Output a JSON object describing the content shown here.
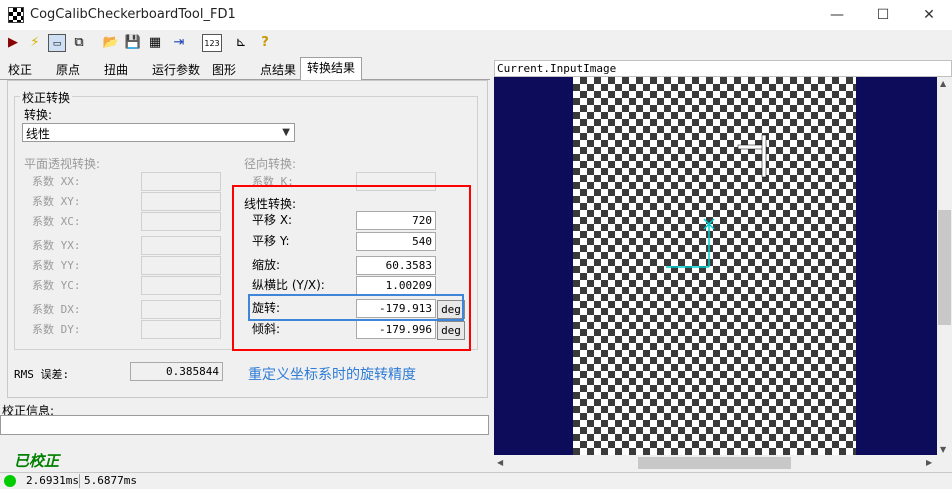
{
  "window": {
    "title": "CogCalibCheckerboardTool_FD1"
  },
  "window_controls": {
    "minimize": "—",
    "maximize": "☐",
    "close": "✕"
  },
  "tabs": [
    {
      "label": "校正"
    },
    {
      "label": "原点"
    },
    {
      "label": "扭曲"
    },
    {
      "label": "运行参数"
    },
    {
      "label": "图形"
    },
    {
      "label": "点结果"
    },
    {
      "label": "转换结果",
      "active": true
    }
  ],
  "calib_transform": {
    "group_title": "校正转换",
    "transform_label": "转换:",
    "transform_value": "线性"
  },
  "perspective": {
    "title": "平面透视转换:",
    "rows": [
      "系数 XX:",
      "系数 XY:",
      "系数 XC:",
      "系数 YX:",
      "系数 YY:",
      "系数 YC:",
      "系数 DX:",
      "系数 DY:"
    ]
  },
  "radial": {
    "title": "径向转换:",
    "k_label": "系数 K:"
  },
  "linear": {
    "title": "线性转换:",
    "translate_x_label": "平移 X:",
    "translate_x": "720",
    "translate_y_label": "平移 Y:",
    "translate_y": "540",
    "scale_label": "缩放:",
    "scale": "60.3583",
    "aspect_label": "纵横比 (Y/X):",
    "aspect": "1.00209",
    "rotation_label": "旋转:",
    "rotation": "-179.913",
    "skew_label": "倾斜:",
    "skew": "-179.996",
    "deg_label": "deg"
  },
  "rms": {
    "label": "RMS 误差:",
    "value": "0.385844"
  },
  "annotation": {
    "text": "重定义坐标系时的旋转精度"
  },
  "calib_info": {
    "label": "校正信息:"
  },
  "status": {
    "calibrated": "已校正",
    "time1": "2.6931ms",
    "time2": "5.6877ms"
  },
  "image_display": {
    "title": "Current.InputImage"
  },
  "colors": {
    "accent_red": "#ff0000",
    "accent_blue": "#3d86d9",
    "status_green": "#00cc00",
    "image_bg": "#0c0c5a"
  }
}
